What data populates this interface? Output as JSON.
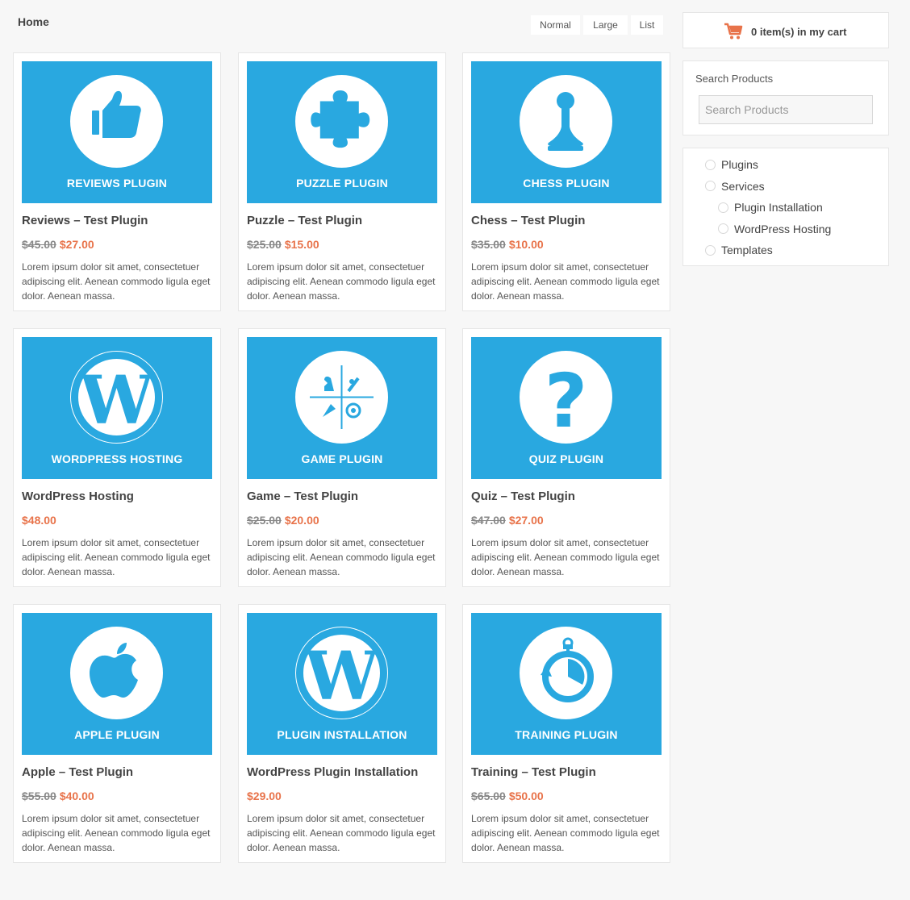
{
  "breadcrumb": "Home",
  "view_options": {
    "normal": "Normal",
    "large": "Large",
    "list": "List"
  },
  "cart": {
    "text": "0 item(s) in my cart",
    "icon": "cart-icon",
    "color": "#e8734a"
  },
  "search": {
    "title": "Search Products",
    "placeholder": "Search Products",
    "value": ""
  },
  "categories": [
    {
      "label": "Plugins",
      "level": 0
    },
    {
      "label": "Services",
      "level": 0
    },
    {
      "label": "Plugin Installation",
      "level": 1
    },
    {
      "label": "WordPress Hosting",
      "level": 1
    },
    {
      "label": "Templates",
      "level": 0
    }
  ],
  "colors": {
    "thumb_bg": "#29a8e0",
    "sale_price": "#e8734a",
    "old_price": "#888888"
  },
  "products": [
    {
      "banner": "REVIEWS PLUGIN",
      "title": "Reviews – Test Plugin",
      "old_price": "$45.00",
      "price": "$27.00",
      "icon": "thumbs-up-icon",
      "desc": "Lorem ipsum dolor sit amet, consectetuer adipiscing elit. Aenean commodo ligula eget dolor. Aenean massa."
    },
    {
      "banner": "PUZZLE PLUGIN",
      "title": "Puzzle – Test Plugin",
      "old_price": "$25.00",
      "price": "$15.00",
      "icon": "puzzle-icon",
      "desc": "Lorem ipsum dolor sit amet, consectetuer adipiscing elit. Aenean commodo ligula eget dolor. Aenean massa."
    },
    {
      "banner": "CHESS PLUGIN",
      "title": "Chess – Test Plugin",
      "old_price": "$35.00",
      "price": "$10.00",
      "icon": "chess-pawn-icon",
      "desc": "Lorem ipsum dolor sit amet, consectetuer adipiscing elit. Aenean commodo ligula eget dolor. Aenean massa."
    },
    {
      "banner": "WORDPRESS HOSTING",
      "title": "WordPress Hosting",
      "old_price": "",
      "price": "$48.00",
      "icon": "wordpress-icon",
      "desc": "Lorem ipsum dolor sit amet, consectetuer adipiscing elit. Aenean commodo ligula eget dolor. Aenean massa."
    },
    {
      "banner": "GAME PLUGIN",
      "title": "Game – Test Plugin",
      "old_price": "$25.00",
      "price": "$20.00",
      "icon": "game-icon",
      "desc": "Lorem ipsum dolor sit amet, consectetuer adipiscing elit. Aenean commodo ligula eget dolor. Aenean massa."
    },
    {
      "banner": "QUIZ PLUGIN",
      "title": "Quiz – Test Plugin",
      "old_price": "$47.00",
      "price": "$27.00",
      "icon": "question-mark-icon",
      "desc": "Lorem ipsum dolor sit amet, consectetuer adipiscing elit. Aenean commodo ligula eget dolor. Aenean massa."
    },
    {
      "banner": "APPLE PLUGIN",
      "title": "Apple – Test Plugin",
      "old_price": "$55.00",
      "price": "$40.00",
      "icon": "apple-icon",
      "desc": "Lorem ipsum dolor sit amet, consectetuer adipiscing elit. Aenean commodo ligula eget dolor. Aenean massa."
    },
    {
      "banner": "PLUGIN INSTALLATION",
      "title": "WordPress Plugin Installation",
      "old_price": "",
      "price": "$29.00",
      "icon": "wordpress-icon",
      "desc": "Lorem ipsum dolor sit amet, consectetuer adipiscing elit. Aenean commodo ligula eget dolor. Aenean massa."
    },
    {
      "banner": "TRAINING PLUGIN",
      "title": "Training – Test Plugin",
      "old_price": "$65.00",
      "price": "$50.00",
      "icon": "stopwatch-icon",
      "desc": "Lorem ipsum dolor sit amet, consectetuer adipiscing elit. Aenean commodo ligula eget dolor. Aenean massa."
    }
  ]
}
